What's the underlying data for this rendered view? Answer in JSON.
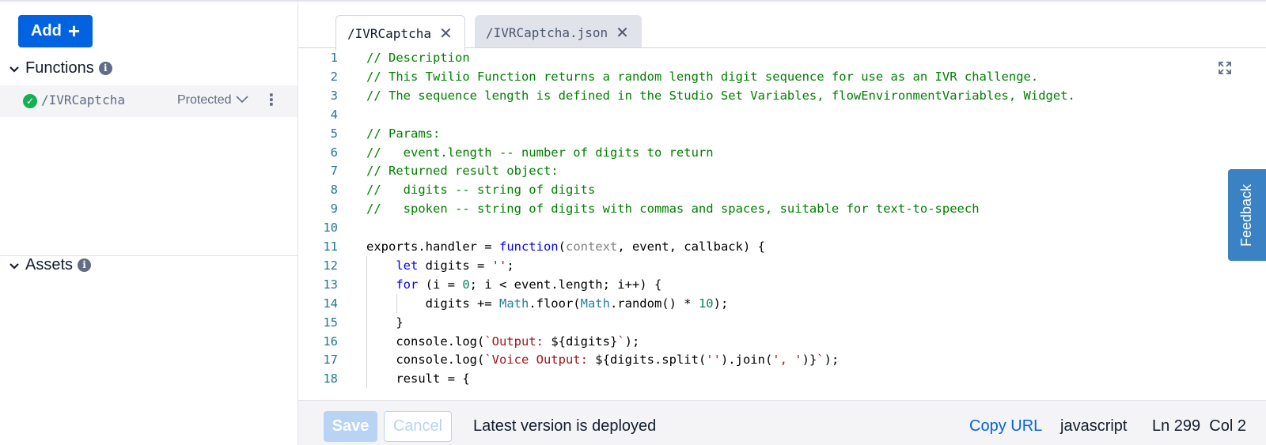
{
  "sidebar": {
    "add_label": "Add",
    "functions_label": "Functions",
    "assets_label": "Assets",
    "function_item": {
      "name": "/IVRCaptcha",
      "visibility": "Protected"
    }
  },
  "tabs": [
    {
      "label": "/IVRCaptcha",
      "active": true
    },
    {
      "label": "/IVRCaptcha.json",
      "active": false
    }
  ],
  "editor": {
    "lines": [
      {
        "n": "1",
        "parts": [
          {
            "t": "// Description",
            "c": "cm"
          }
        ]
      },
      {
        "n": "2",
        "parts": [
          {
            "t": "// This Twilio Function returns a random length digit sequence for use as an IVR challenge.",
            "c": "cm"
          }
        ]
      },
      {
        "n": "3",
        "parts": [
          {
            "t": "// The sequence length is defined in the Studio Set Variables, flowEnvironmentVariables, Widget.",
            "c": "cm"
          }
        ]
      },
      {
        "n": "4",
        "parts": []
      },
      {
        "n": "5",
        "parts": [
          {
            "t": "// Params:",
            "c": "cm"
          }
        ]
      },
      {
        "n": "6",
        "parts": [
          {
            "t": "//   event.length -- number of digits to return",
            "c": "cm"
          }
        ]
      },
      {
        "n": "7",
        "parts": [
          {
            "t": "// Returned result object:",
            "c": "cm"
          }
        ]
      },
      {
        "n": "8",
        "parts": [
          {
            "t": "//   digits -- string of digits",
            "c": "cm"
          }
        ]
      },
      {
        "n": "9",
        "parts": [
          {
            "t": "//   spoken -- string of digits with commas and spaces, suitable for text-to-speech",
            "c": "cm"
          }
        ]
      },
      {
        "n": "10",
        "parts": []
      },
      {
        "n": "11",
        "parts": [
          {
            "t": "exports.handler = ",
            "c": ""
          },
          {
            "t": "function",
            "c": "kw"
          },
          {
            "t": "(",
            "c": ""
          },
          {
            "t": "context",
            "c": "pa"
          },
          {
            "t": ", event, callback) {",
            "c": ""
          }
        ]
      },
      {
        "n": "12",
        "parts": [
          {
            "t": "    ",
            "c": ""
          },
          {
            "t": "let",
            "c": "kw"
          },
          {
            "t": " digits = ",
            "c": ""
          },
          {
            "t": "''",
            "c": "st"
          },
          {
            "t": ";",
            "c": ""
          }
        ]
      },
      {
        "n": "13",
        "parts": [
          {
            "t": "    ",
            "c": ""
          },
          {
            "t": "for",
            "c": "kw"
          },
          {
            "t": " (i = ",
            "c": ""
          },
          {
            "t": "0",
            "c": "nm"
          },
          {
            "t": "; i < event.length; i++) {",
            "c": ""
          }
        ]
      },
      {
        "n": "14",
        "parts": [
          {
            "t": "        digits += ",
            "c": ""
          },
          {
            "t": "Math",
            "c": "ty"
          },
          {
            "t": ".floor(",
            "c": ""
          },
          {
            "t": "Math",
            "c": "ty"
          },
          {
            "t": ".random() * ",
            "c": ""
          },
          {
            "t": "10",
            "c": "nm"
          },
          {
            "t": ");",
            "c": ""
          }
        ]
      },
      {
        "n": "15",
        "parts": [
          {
            "t": "    }",
            "c": ""
          }
        ]
      },
      {
        "n": "16",
        "parts": [
          {
            "t": "    console.log(",
            "c": ""
          },
          {
            "t": "`Output: ",
            "c": "st"
          },
          {
            "t": "${digits}",
            "c": ""
          },
          {
            "t": "`",
            "c": "st"
          },
          {
            "t": ");",
            "c": ""
          }
        ]
      },
      {
        "n": "17",
        "parts": [
          {
            "t": "    console.log(",
            "c": ""
          },
          {
            "t": "`Voice Output: ",
            "c": "st"
          },
          {
            "t": "${digits.split(",
            "c": ""
          },
          {
            "t": "''",
            "c": "st"
          },
          {
            "t": ").join(",
            "c": ""
          },
          {
            "t": "', '",
            "c": "st"
          },
          {
            "t": ")}",
            "c": ""
          },
          {
            "t": "`",
            "c": "st"
          },
          {
            "t": ");",
            "c": ""
          }
        ]
      },
      {
        "n": "18",
        "parts": [
          {
            "t": "    result = {",
            "c": ""
          }
        ]
      }
    ]
  },
  "feedback_label": "Feedback",
  "statusbar": {
    "save_label": "Save",
    "cancel_label": "Cancel",
    "status": "Latest version is deployed",
    "copy_url": "Copy URL",
    "language": "javascript",
    "position": "Ln 299  Col 2"
  },
  "colors": {
    "accent": "#0263e0",
    "success": "#14b053",
    "comment": "#008000",
    "keyword": "#0000ff"
  },
  "icons": [
    "plus-icon",
    "chevron-down-icon",
    "info-icon",
    "check-circle-icon",
    "kebab-icon",
    "close-icon",
    "expand-icon"
  ]
}
